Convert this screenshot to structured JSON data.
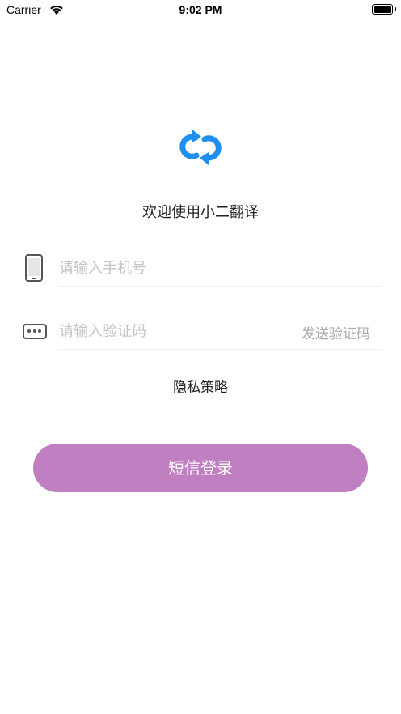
{
  "status_bar": {
    "carrier": "Carrier",
    "time": "9:02 PM"
  },
  "icons": {
    "logo": "app-logo-icon",
    "phone": "phone-icon",
    "code": "password-dots-icon",
    "wifi": "wifi-icon",
    "battery": "battery-icon"
  },
  "colors": {
    "accent": "#bf7fc0",
    "logo_blue": "#1e8ef0"
  },
  "welcome_text": "欢迎使用小二翻译",
  "phone_field": {
    "placeholder": "请输入手机号",
    "value": ""
  },
  "code_field": {
    "placeholder": "请输入验证码",
    "value": "",
    "send_code_label": "发送验证码"
  },
  "privacy_label": "隐私策略",
  "login_button_label": "短信登录"
}
